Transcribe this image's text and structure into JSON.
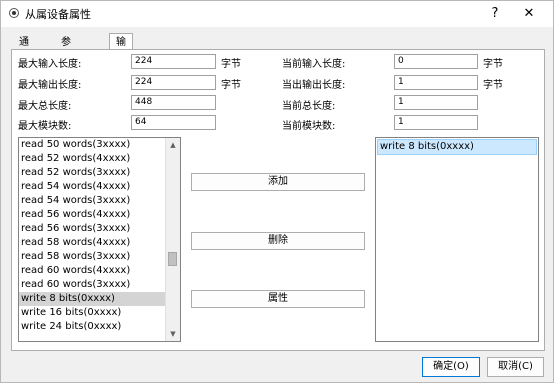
{
  "window": {
    "title": "从属设备属性",
    "help": "?",
    "close": "✕"
  },
  "tabs": [
    {
      "label": "通用"
    },
    {
      "label": "参数设置"
    },
    {
      "label": "输入输出"
    }
  ],
  "left_fields": [
    {
      "label": "最大输入长度:",
      "value": "224",
      "unit": "字节"
    },
    {
      "label": "最大输出长度:",
      "value": "224",
      "unit": "字节"
    },
    {
      "label": "最大总长度:",
      "value": "448",
      "unit": ""
    },
    {
      "label": "最大模块数:",
      "value": "64",
      "unit": ""
    }
  ],
  "right_fields": [
    {
      "label": "当前输入长度:",
      "value": "0",
      "unit": "字节"
    },
    {
      "label": "当出输出长度:",
      "value": "1",
      "unit": "字节"
    },
    {
      "label": "当前总长度:",
      "value": "1",
      "unit": ""
    },
    {
      "label": "当前模块数:",
      "value": "1",
      "unit": ""
    }
  ],
  "module_list": [
    "read 50 words(3xxxx)",
    "read 52 words(4xxxx)",
    "read 52 words(3xxxx)",
    "read 54 words(4xxxx)",
    "read 54 words(3xxxx)",
    "read 56 words(4xxxx)",
    "read 56 words(3xxxx)",
    "read 58 words(4xxxx)",
    "read 58 words(3xxxx)",
    "read 60 words(4xxxx)",
    "read 60 words(3xxxx)",
    "write 8 bits(0xxxx)",
    "write 16 bits(0xxxx)",
    "write 24 bits(0xxxx)"
  ],
  "selected_module": "write 8 bits(0xxxx)",
  "buttons": {
    "add": "添加",
    "delete": "删除",
    "properties": "属性"
  },
  "configured_list": [
    "write 8 bits(0xxxx)"
  ],
  "footer": {
    "ok": "确定(O)",
    "cancel": "取消(C)"
  }
}
